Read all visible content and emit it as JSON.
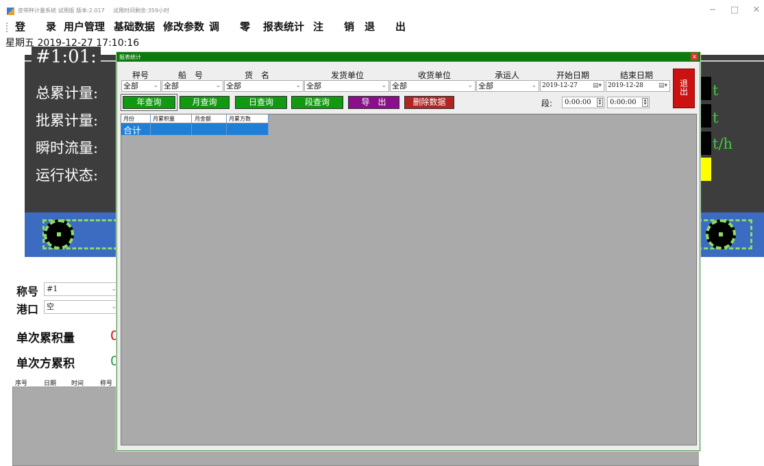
{
  "window": {
    "title": "皮带秤计量系统 试用版 版本:2.017",
    "trial": "试用时间剩余:359小时",
    "minimize": "−",
    "maximize": "□",
    "close": "✕"
  },
  "menu": {
    "login": "登　　录",
    "users": "用户管理",
    "base_data": "基础数据",
    "params": "修改参数",
    "zero": "调　　零",
    "report": "报表统计",
    "logout": "注　　销",
    "exit": "退　　出"
  },
  "datetime": "星期五  2019-12-27  17:10:16",
  "scale": {
    "id": "#1:01:",
    "total_label": "总累计量:",
    "batch_label": "批累计量:",
    "flow_label": "瞬时流量:",
    "status_label": "运行状态:",
    "unit_total": "t",
    "unit_batch": "t",
    "unit_flow": "t/h"
  },
  "left_form": {
    "scale_no_label": "称号",
    "scale_no_value": "#1",
    "port_label": "港口",
    "port_value": "空",
    "single_label": "单次累积量",
    "single_value": "0",
    "single_vol_label": "单次方累积",
    "single_vol_value": "0"
  },
  "bottom_grid": {
    "headers": [
      "序号",
      "日期",
      "时间",
      "称号"
    ]
  },
  "dialog": {
    "title": "报表统计",
    "close": "x",
    "exit_label": "退\n出",
    "filters": {
      "scale_label": "秤号",
      "ship_label": "船　号",
      "cargo_label": "货　名",
      "sender_label": "发货单位",
      "receiver_label": "收货单位",
      "carrier_label": "承运人",
      "start_label": "开始日期",
      "end_label": "结束日期",
      "scale_value": "全部",
      "ship_value": "全部",
      "cargo_value": "全部",
      "sender_value": "全部",
      "receiver_value": "全部",
      "carrier_value": "全部",
      "start_value": "2019-12-27",
      "end_value": "2019-12-28"
    },
    "buttons": {
      "year": "年查询",
      "month": "月查询",
      "day": "日查询",
      "segment": "段查询",
      "export": "导　出",
      "delete": "删除数据"
    },
    "segment": {
      "label": "段:",
      "from": "0:00:00",
      "to": "0:00:00"
    },
    "grid": {
      "headers": [
        "月份",
        "月累积量",
        "月金额",
        "月累方数"
      ],
      "rows": [
        [
          "合计",
          "",
          "",
          ""
        ]
      ]
    }
  },
  "colors": {
    "dialog_title": "#0d7a0d",
    "button_green": "#119911",
    "button_purple": "#8a0f8a",
    "button_red": "#b02424",
    "selected_row": "#1f7fd6",
    "belt": "#3b6cc2"
  }
}
